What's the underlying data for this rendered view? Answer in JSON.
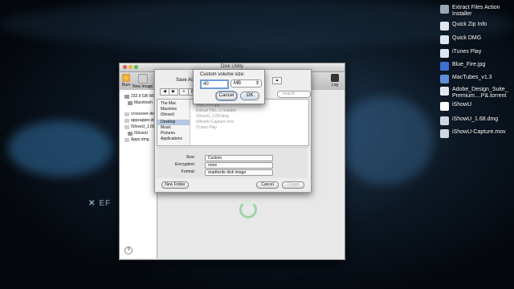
{
  "desktop": {
    "brand_text": "EF",
    "icons": [
      {
        "label_line1": "Extract Files Action",
        "label_line2": "Installer",
        "icon": "automator-action-icon",
        "color": "#9aa7b8"
      },
      {
        "label_line1": "Quick Zip Info",
        "label_line2": "",
        "icon": "document-icon",
        "color": "#dfe6ef"
      },
      {
        "label_line1": "Quick DMG",
        "label_line2": "",
        "icon": "document-icon",
        "color": "#dfe6ef"
      },
      {
        "label_line1": "iTunes Play",
        "label_line2": "",
        "icon": "document-icon",
        "color": "#dfe6ef"
      },
      {
        "label_line1": "Blue_Fire.jpg",
        "label_line2": "",
        "icon": "image-file-icon",
        "color": "#3f6fd0"
      },
      {
        "label_line1": "MacTubes_v1.3",
        "label_line2": "",
        "icon": "app-icon",
        "color": "#5f8fd8"
      },
      {
        "label_line1": "Adobe_Design_Suite_",
        "label_line2": "Premium....P&.torrent",
        "icon": "torrent-file-icon",
        "color": "#dfe6ef"
      },
      {
        "label_line1": "iShowU",
        "label_line2": "",
        "icon": "app-icon",
        "color": "#ffffff"
      },
      {
        "label_line1": "iShowU_1.68.dmg",
        "label_line2": "",
        "icon": "disk-image-icon",
        "color": "#cfd6df"
      },
      {
        "label_line1": "iShowU-Capture.mov",
        "label_line2": "",
        "icon": "movie-file-icon",
        "color": "#cfd6df"
      }
    ]
  },
  "window": {
    "title": "Disk Utility",
    "toolbar": {
      "burn": "Burn",
      "new_image": "New Image",
      "log": "Log"
    },
    "sidebar": [
      "232.9 GB WD",
      "Macintosh",
      "crossover-de",
      "appzapper.dn",
      "iShowU_1.68",
      "iShowU",
      "Apps.dmg"
    ]
  },
  "save_sheet": {
    "save_as_label": "Save As:",
    "places": [
      "The Mac",
      "Macintos",
      "iShowU",
      "Desktop",
      "Music",
      "Pictures",
      "Applications"
    ],
    "selected_place": "Desktop",
    "files": [
      "Blue_Fire.jpg",
      "Extract File...n Installer",
      "iShowU_1.68.dmg",
      "iShowU-Capture.mov",
      "iTunes Play"
    ],
    "search_placeholder": "search",
    "size_label": "Size:",
    "size_value": "Custom",
    "encryption_label": "Encryption:",
    "encryption_value": "none",
    "format_label": "Format:",
    "format_value": "read/write disk image",
    "new_folder": "New Folder",
    "cancel": "Cancel",
    "create": "Create"
  },
  "popover": {
    "heading": "Custom volume size:",
    "size_value": "40",
    "unit": "MB",
    "cancel": "Cancel",
    "ok": "OK"
  }
}
